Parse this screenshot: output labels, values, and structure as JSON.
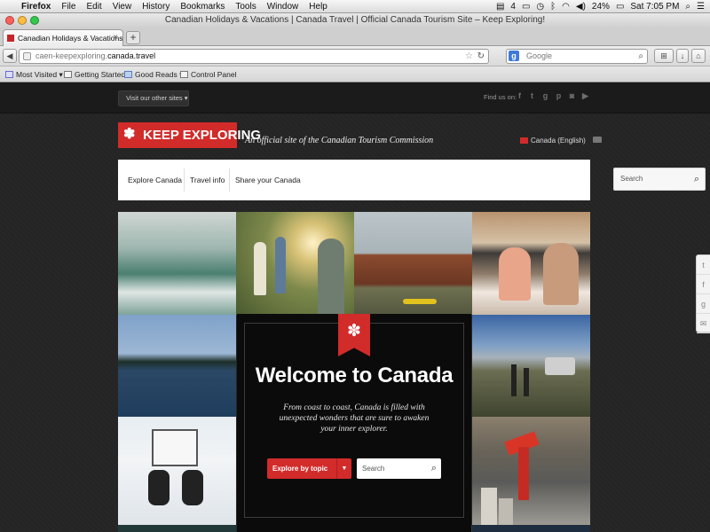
{
  "menubar": {
    "app": "Firefox",
    "items": [
      "File",
      "Edit",
      "View",
      "History",
      "Bookmarks",
      "Tools",
      "Window",
      "Help"
    ],
    "status": {
      "notif_count": "4",
      "battery": "24%",
      "clock": "Sat 7:05 PM"
    }
  },
  "window": {
    "title": "Canadian Holidays & Vacations | Canada Travel | Official Canada Tourism Site – Keep Exploring!"
  },
  "tabs": [
    {
      "label": "Canadian Holidays & Vacations ..."
    }
  ],
  "newtab": "+",
  "navbar": {
    "url_prefix": "caen-keepexploring.",
    "url_host": "canada.travel",
    "search_placeholder": "Google"
  },
  "bookmarks": [
    "Most Visited",
    "Getting Started",
    "Good Reads",
    "Control Panel"
  ],
  "site": {
    "visit_label": "Visit our other sites",
    "find_us": "Find us on:",
    "logo": "KEEP EXPLORING",
    "tagline": "An official site of the Canadian Tourism Commission",
    "language": "Canada (English)",
    "nav": [
      "Explore Canada",
      "Travel info",
      "Share your Canada"
    ],
    "search_placeholder": "Search",
    "welcome": {
      "heading": "Welcome to Canada",
      "body": "From coast to coast, Canada is filled with unexpected wonders that are sure to awaken your inner explorer.",
      "explore_label": "Explore by topic",
      "search_placeholder": "Search"
    }
  },
  "colors": {
    "brand_red": "#d12b2a",
    "site_bg": "#242424"
  }
}
